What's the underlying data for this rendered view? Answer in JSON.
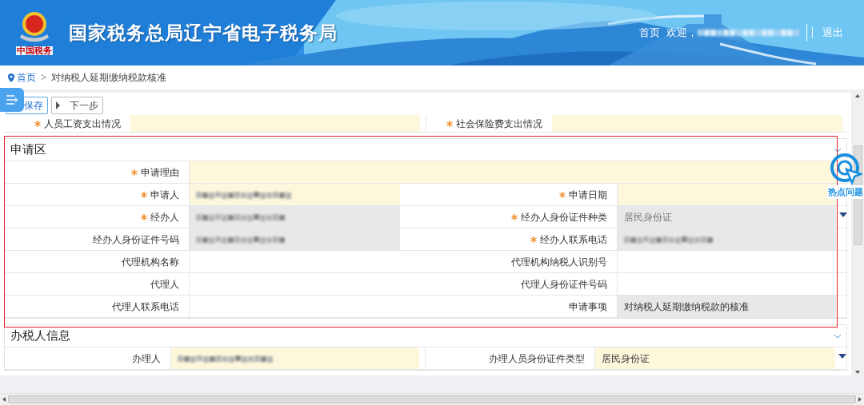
{
  "header": {
    "logo_caption": "中国税务",
    "title": "国家税务总局辽宁省电子税务局",
    "home_link": "首页",
    "welcome": "欢迎，",
    "welcome_name_redacted": true,
    "logout": "退出"
  },
  "breadcrumb": {
    "home": "首页",
    "separator": ">",
    "current": "对纳税人延期缴纳税款核准"
  },
  "toolbar": {
    "buttons": [
      {
        "label": "保存",
        "kind": "save"
      },
      {
        "label": "下一步",
        "kind": "next"
      }
    ]
  },
  "top_row": [
    {
      "label": "人员工资支出情况",
      "required": true,
      "kind": "editable"
    },
    {
      "label": "社会保险费支出情况",
      "required": true,
      "kind": "editable"
    }
  ],
  "sections": [
    {
      "title": "申请区",
      "expanded": true,
      "highlighted": true,
      "rows": [
        [
          {
            "label": "申请理由",
            "required": true,
            "kind": "editable"
          }
        ],
        [
          {
            "label": "申请人",
            "required": true,
            "kind": "editable",
            "redacted": true
          },
          {
            "label": "申请日期",
            "required": true,
            "kind": "editable"
          }
        ],
        [
          {
            "label": "经办人",
            "required": true,
            "kind": "readonly",
            "redacted": true
          },
          {
            "label": "经办人身份证件种类",
            "required": true,
            "kind": "readonly",
            "value": "居民身份证",
            "dropdown": true
          }
        ],
        [
          {
            "label": "经办人身份证件号码",
            "required": false,
            "kind": "readonly",
            "redacted": true
          },
          {
            "label": "经办人联系电话",
            "required": true,
            "kind": "readonly",
            "redacted": true
          }
        ],
        [
          {
            "label": "代理机构名称",
            "required": false,
            "kind": "plain"
          },
          {
            "label": "代理机构纳税人识别号",
            "required": false,
            "kind": "plain"
          }
        ],
        [
          {
            "label": "代理人",
            "required": false,
            "kind": "plain"
          },
          {
            "label": "代理人身份证件号码",
            "required": false,
            "kind": "plain"
          }
        ],
        [
          {
            "label": "代理人联系电话",
            "required": false,
            "kind": "plain"
          },
          {
            "label": "申请事项",
            "required": false,
            "kind": "readonly",
            "value": "对纳税人延期缴纳税款的核准"
          }
        ]
      ]
    },
    {
      "title": "办税人信息",
      "expanded": true,
      "highlighted": false,
      "rows": [
        [
          {
            "label": "办理人",
            "required": false,
            "kind": "editable",
            "redacted": true
          },
          {
            "label": "办理人员身份证件类型",
            "required": false,
            "kind": "editable",
            "value": "居民身份证",
            "dropdown": true
          }
        ]
      ]
    }
  ],
  "hot_questions": "热点问题"
}
